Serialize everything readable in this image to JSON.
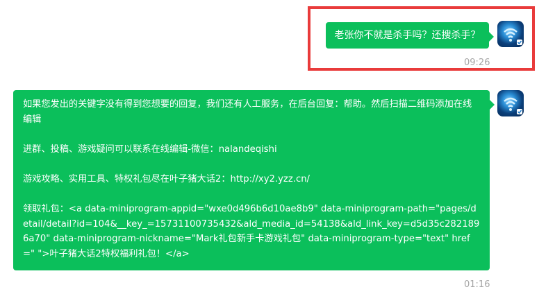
{
  "messages": [
    {
      "text": "老张你不就是杀手吗？还搜杀手？",
      "time": "09:26"
    },
    {
      "paragraphs": [
        "如果您发出的关键字没有得到您想要的回复，我们还有人工服务，在后台回复：帮助。然后扫描二维码添加在线编辑",
        "进群、投稿、游戏疑问可以联系在线编辑-微信：nalandeqishi",
        "游戏攻略、实用工具、特权礼包尽在叶子猪大话2：http://xy2.yzz.cn/",
        "领取礼包：<a data-miniprogram-appid=\"wxe0d496b6d10ae8b9\" data-miniprogram-path=\"pages/detail/detail?id=104&__key_=15731100735432&ald_media_id=54138&ald_link_key=d5d35c2821896a70\" data-miniprogram-nickname=\"Mark礼包新手卡游戏礼包\" data-miniprogram-type=\"text\" href=\" \">叶子猪大话2特权福利礼包！</a>"
      ],
      "time": "01:16"
    }
  ],
  "colors": {
    "bubble": "#0bbf5b",
    "highlight": "#e93b3b",
    "timestamp": "#a6a6a6"
  },
  "icons": {
    "avatar": "wifi-avatar-icon"
  }
}
